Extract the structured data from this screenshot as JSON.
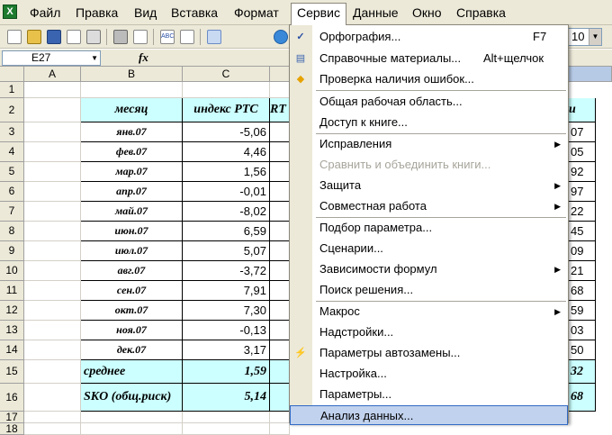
{
  "menubar": {
    "items": [
      "Файл",
      "Правка",
      "Вид",
      "Вставка",
      "Формат",
      "Сервис",
      "Данные",
      "Окно",
      "Справка"
    ],
    "active_index": 5
  },
  "toolbar": {
    "font_size_value": "10"
  },
  "formula_bar": {
    "name_box": "E27",
    "fx_label": "fx"
  },
  "columns": [
    "A",
    "B",
    "C"
  ],
  "rows": [
    "1",
    "2",
    "3",
    "4",
    "5",
    "6",
    "7",
    "8",
    "9",
    "10",
    "11",
    "12",
    "13",
    "14",
    "15",
    "16",
    "17",
    "18"
  ],
  "table": {
    "header": {
      "month": "месяц",
      "index": "индекс РТС",
      "partial": "RT",
      "right_partial": "и"
    },
    "data": [
      {
        "month": "янв.07",
        "value": "-5,06",
        "right": "07"
      },
      {
        "month": "фев.07",
        "value": "4,46",
        "right": "05"
      },
      {
        "month": "мар.07",
        "value": "1,56",
        "right": "92"
      },
      {
        "month": "апр.07",
        "value": "-0,01",
        "right": "97"
      },
      {
        "month": "май.07",
        "value": "-8,02",
        "right": "22"
      },
      {
        "month": "июн.07",
        "value": "6,59",
        "right": "45"
      },
      {
        "month": "июл.07",
        "value": "5,07",
        "right": "09"
      },
      {
        "month": "авг.07",
        "value": "-3,72",
        "right": "21"
      },
      {
        "month": "сен.07",
        "value": "7,91",
        "right": "68"
      },
      {
        "month": "окт.07",
        "value": "7,30",
        "right": "59"
      },
      {
        "month": "ноя.07",
        "value": "-0,13",
        "right": "03"
      },
      {
        "month": "дек.07",
        "value": "3,17",
        "right": "50"
      }
    ],
    "summary": [
      {
        "label": "среднее",
        "value": "1,59",
        "right": "32"
      },
      {
        "label": "SKO (общ.риск)",
        "value": "5,14",
        "right": "68"
      }
    ]
  },
  "dropdown": {
    "items": [
      {
        "label": "Орфография...",
        "shortcut": "F7",
        "icon": "spellcheck-icon",
        "submenu": false,
        "disabled": false
      },
      {
        "label": "Справочные материалы...",
        "shortcut": "Alt+щелчок",
        "icon": "research-icon",
        "submenu": false,
        "disabled": false
      },
      {
        "label": "Проверка наличия ошибок...",
        "shortcut": "",
        "icon": "error-check-icon",
        "submenu": false,
        "disabled": false,
        "sep_after": true
      },
      {
        "label": "Общая рабочая область...",
        "shortcut": "",
        "icon": "",
        "submenu": false,
        "disabled": false
      },
      {
        "label": "Доступ к книге...",
        "shortcut": "",
        "icon": "",
        "submenu": false,
        "disabled": false,
        "sep_after": true
      },
      {
        "label": "Исправления",
        "shortcut": "",
        "icon": "",
        "submenu": true,
        "disabled": false
      },
      {
        "label": "Сравнить и объединить книги...",
        "shortcut": "",
        "icon": "",
        "submenu": false,
        "disabled": true
      },
      {
        "label": "Защита",
        "shortcut": "",
        "icon": "",
        "submenu": true,
        "disabled": false
      },
      {
        "label": "Совместная работа",
        "shortcut": "",
        "icon": "",
        "submenu": true,
        "disabled": false,
        "sep_after": true
      },
      {
        "label": "Подбор параметра...",
        "shortcut": "",
        "icon": "",
        "submenu": false,
        "disabled": false
      },
      {
        "label": "Сценарии...",
        "shortcut": "",
        "icon": "",
        "submenu": false,
        "disabled": false
      },
      {
        "label": "Зависимости формул",
        "shortcut": "",
        "icon": "",
        "submenu": true,
        "disabled": false
      },
      {
        "label": "Поиск решения...",
        "shortcut": "",
        "icon": "",
        "submenu": false,
        "disabled": false,
        "sep_after": true
      },
      {
        "label": "Макрос",
        "shortcut": "",
        "icon": "",
        "submenu": true,
        "disabled": false
      },
      {
        "label": "Надстройки...",
        "shortcut": "",
        "icon": "",
        "submenu": false,
        "disabled": false
      },
      {
        "label": "Параметры автозамены...",
        "shortcut": "",
        "icon": "autocorrect-icon",
        "submenu": false,
        "disabled": false
      },
      {
        "label": "Настройка...",
        "shortcut": "",
        "icon": "",
        "submenu": false,
        "disabled": false
      },
      {
        "label": "Параметры...",
        "shortcut": "",
        "icon": "",
        "submenu": false,
        "disabled": false,
        "sep_after": true
      },
      {
        "label": "Анализ данных...",
        "shortcut": "",
        "icon": "",
        "submenu": false,
        "disabled": false,
        "highlighted": true
      }
    ]
  },
  "colors": {
    "chrome": "#ece9d8",
    "cell_fill": "#ccffff",
    "highlight": "#c1d2ee",
    "highlight_border": "#316ac5"
  }
}
